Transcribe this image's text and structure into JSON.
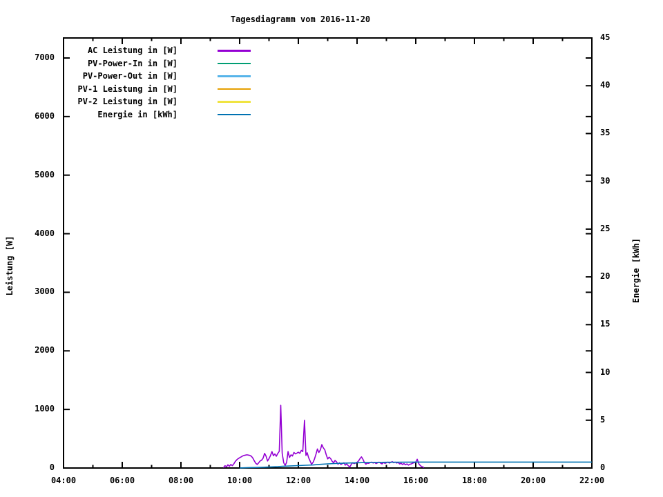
{
  "title": "Tagesdiagramm vom 2016-11-20",
  "chart_data": {
    "type": "line",
    "title": "Tagesdiagramm vom 2016-11-20",
    "grid": false,
    "legend_position": "top-left-inside",
    "x_axis": {
      "label": "",
      "start_hour": 4,
      "end_hour": 22,
      "major_tick_hours": [
        4,
        6,
        8,
        10,
        12,
        14,
        16,
        18,
        20,
        22
      ],
      "major_tick_labels": [
        "04:00",
        "06:00",
        "08:00",
        "10:00",
        "12:00",
        "14:00",
        "16:00",
        "18:00",
        "20:00",
        "22:00"
      ],
      "minor_tick_hours": [
        5,
        7,
        9,
        11,
        13,
        15,
        17,
        19,
        21
      ]
    },
    "y1_axis": {
      "label": "Leistung [W]",
      "min": 0,
      "max": 7340,
      "ticks": [
        0,
        1000,
        2000,
        3000,
        4000,
        5000,
        6000,
        7000
      ]
    },
    "y2_axis": {
      "label": "Energie [kWh]",
      "min": 0,
      "max": 45,
      "ticks": [
        0,
        5,
        10,
        15,
        20,
        25,
        30,
        35,
        40,
        45
      ]
    },
    "series": [
      {
        "label": "AC Leistung in [W]",
        "color": "#9400d3",
        "axis": "y1",
        "points": [
          [
            9.45,
            5
          ],
          [
            9.5,
            40
          ],
          [
            9.55,
            20
          ],
          [
            9.6,
            55
          ],
          [
            9.65,
            30
          ],
          [
            9.7,
            60
          ],
          [
            9.75,
            40
          ],
          [
            9.8,
            70
          ],
          [
            9.85,
            110
          ],
          [
            9.9,
            140
          ],
          [
            9.95,
            160
          ],
          [
            10.0,
            175
          ],
          [
            10.05,
            190
          ],
          [
            10.1,
            205
          ],
          [
            10.15,
            215
          ],
          [
            10.2,
            220
          ],
          [
            10.25,
            225
          ],
          [
            10.3,
            220
          ],
          [
            10.35,
            215
          ],
          [
            10.4,
            200
          ],
          [
            10.45,
            170
          ],
          [
            10.5,
            120
          ],
          [
            10.55,
            80
          ],
          [
            10.6,
            60
          ],
          [
            10.65,
            90
          ],
          [
            10.7,
            120
          ],
          [
            10.75,
            135
          ],
          [
            10.8,
            170
          ],
          [
            10.85,
            250
          ],
          [
            10.9,
            200
          ],
          [
            10.95,
            120
          ],
          [
            11.0,
            160
          ],
          [
            11.05,
            210
          ],
          [
            11.1,
            280
          ],
          [
            11.15,
            210
          ],
          [
            11.2,
            240
          ],
          [
            11.25,
            200
          ],
          [
            11.3,
            250
          ],
          [
            11.35,
            285
          ],
          [
            11.4,
            1070
          ],
          [
            11.45,
            250
          ],
          [
            11.5,
            90
          ],
          [
            11.55,
            45
          ],
          [
            11.6,
            95
          ],
          [
            11.65,
            280
          ],
          [
            11.7,
            180
          ],
          [
            11.75,
            225
          ],
          [
            11.8,
            205
          ],
          [
            11.85,
            265
          ],
          [
            11.9,
            240
          ],
          [
            11.95,
            255
          ],
          [
            12.0,
            270
          ],
          [
            12.05,
            250
          ],
          [
            12.1,
            300
          ],
          [
            12.15,
            280
          ],
          [
            12.21,
            815
          ],
          [
            12.26,
            215
          ],
          [
            12.3,
            260
          ],
          [
            12.35,
            175
          ],
          [
            12.4,
            120
          ],
          [
            12.45,
            65
          ],
          [
            12.5,
            95
          ],
          [
            12.55,
            155
          ],
          [
            12.6,
            235
          ],
          [
            12.65,
            325
          ],
          [
            12.7,
            265
          ],
          [
            12.75,
            310
          ],
          [
            12.8,
            400
          ],
          [
            12.85,
            345
          ],
          [
            12.9,
            310
          ],
          [
            12.95,
            225
          ],
          [
            13.0,
            155
          ],
          [
            13.05,
            185
          ],
          [
            13.1,
            160
          ],
          [
            13.15,
            115
          ],
          [
            13.2,
            90
          ],
          [
            13.25,
            130
          ],
          [
            13.3,
            105
          ],
          [
            13.35,
            65
          ],
          [
            13.4,
            90
          ],
          [
            13.45,
            60
          ],
          [
            13.5,
            75
          ],
          [
            13.55,
            90
          ],
          [
            13.6,
            50
          ],
          [
            13.65,
            70
          ],
          [
            13.7,
            40
          ],
          [
            13.75,
            15
          ],
          [
            13.8,
            60
          ],
          [
            13.85,
            90
          ],
          [
            13.9,
            75
          ],
          [
            13.95,
            85
          ],
          [
            14.0,
            95
          ],
          [
            14.05,
            120
          ],
          [
            14.1,
            160
          ],
          [
            14.15,
            190
          ],
          [
            14.2,
            150
          ],
          [
            14.25,
            95
          ],
          [
            14.3,
            65
          ],
          [
            14.35,
            85
          ],
          [
            14.4,
            80
          ],
          [
            14.45,
            95
          ],
          [
            14.5,
            100
          ],
          [
            14.55,
            85
          ],
          [
            14.6,
            95
          ],
          [
            14.65,
            75
          ],
          [
            14.7,
            90
          ],
          [
            14.75,
            100
          ],
          [
            14.8,
            85
          ],
          [
            14.85,
            70
          ],
          [
            14.9,
            95
          ],
          [
            14.95,
            80
          ],
          [
            15.0,
            90
          ],
          [
            15.05,
            100
          ],
          [
            15.1,
            85
          ],
          [
            15.15,
            95
          ],
          [
            15.2,
            110
          ],
          [
            15.25,
            90
          ],
          [
            15.3,
            100
          ],
          [
            15.35,
            85
          ],
          [
            15.4,
            95
          ],
          [
            15.45,
            70
          ],
          [
            15.5,
            80
          ],
          [
            15.55,
            60
          ],
          [
            15.6,
            75
          ],
          [
            15.65,
            55
          ],
          [
            15.7,
            70
          ],
          [
            15.75,
            50
          ],
          [
            15.8,
            65
          ],
          [
            15.85,
            70
          ],
          [
            15.9,
            85
          ],
          [
            15.95,
            90
          ],
          [
            16.0,
            100
          ],
          [
            16.05,
            150
          ],
          [
            16.1,
            75
          ],
          [
            16.15,
            45
          ],
          [
            16.2,
            25
          ],
          [
            16.28,
            10
          ]
        ]
      },
      {
        "label": "PV-Power-In in [W]",
        "color": "#009e73",
        "axis": "y1",
        "points": []
      },
      {
        "label": "PV-Power-Out in [W]",
        "color": "#56b4e9",
        "axis": "y1",
        "points": []
      },
      {
        "label": "PV-1 Leistung in [W]",
        "color": "#e69f00",
        "axis": "y1",
        "points": []
      },
      {
        "label": "PV-2 Leistung in [W]",
        "color": "#f0e442",
        "axis": "y1",
        "points": []
      },
      {
        "label": "Energie in [kWh]",
        "color": "#0072b2",
        "axis": "y2",
        "points": [
          [
            10.0,
            0.01
          ],
          [
            10.3,
            0.04
          ],
          [
            10.6,
            0.06
          ],
          [
            11.0,
            0.1
          ],
          [
            11.3,
            0.14
          ],
          [
            11.45,
            0.18
          ],
          [
            11.7,
            0.21
          ],
          [
            12.0,
            0.25
          ],
          [
            12.25,
            0.29
          ],
          [
            12.5,
            0.32
          ],
          [
            12.75,
            0.38
          ],
          [
            13.0,
            0.43
          ],
          [
            13.25,
            0.47
          ],
          [
            13.5,
            0.5
          ],
          [
            13.75,
            0.53
          ],
          [
            14.0,
            0.55
          ],
          [
            14.25,
            0.57
          ],
          [
            14.5,
            0.58
          ],
          [
            15.0,
            0.6
          ],
          [
            15.5,
            0.61
          ],
          [
            16.0,
            0.62
          ],
          [
            16.3,
            0.62
          ],
          [
            22.0,
            0.62
          ]
        ]
      }
    ]
  }
}
